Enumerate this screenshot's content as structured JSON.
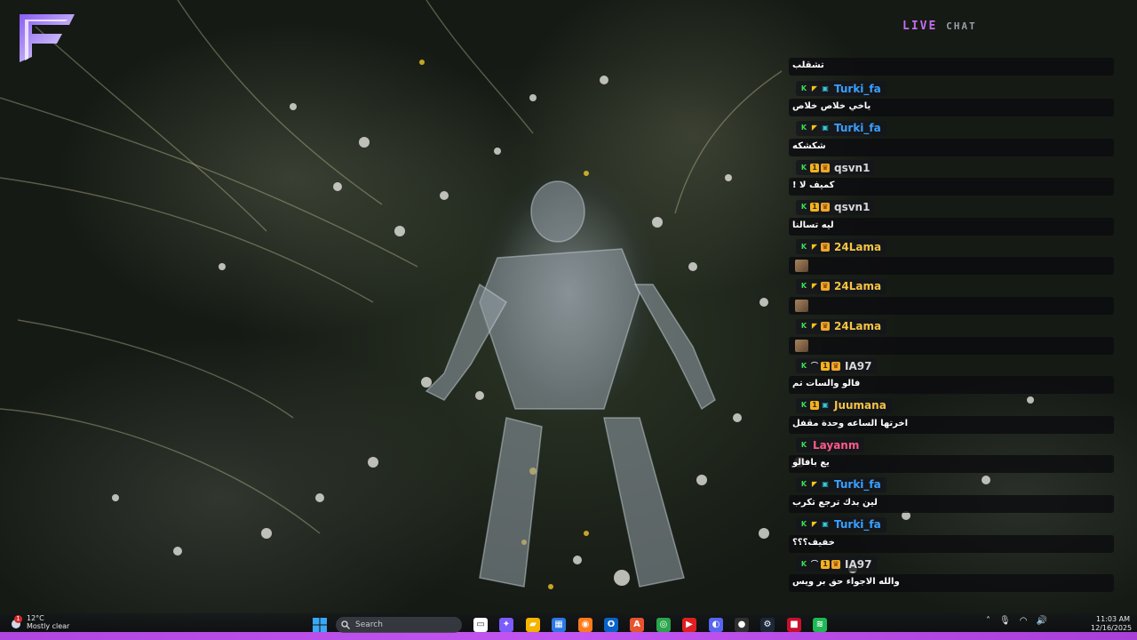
{
  "overlay": {
    "chat_title_part1": "LIVE",
    "chat_title_part2": "CHAT",
    "accent_color": "#c66bf0"
  },
  "chat": {
    "messages": [
      {
        "user": "",
        "color": "#ffffff",
        "badges": [],
        "text": "تشقلب"
      },
      {
        "user": "Turki_fa",
        "color": "#3aa0ff",
        "badges": [
          "k-icon",
          "flag-icon",
          "gamepad-icon"
        ],
        "text": "ياخي خلاص خلاص"
      },
      {
        "user": "Turki_fa",
        "color": "#3aa0ff",
        "badges": [
          "k-icon",
          "flag-icon",
          "gamepad-icon"
        ],
        "text": "شكشكه"
      },
      {
        "user": "qsvn1",
        "color": "#d7d7d7",
        "badges": [
          "k-icon",
          "coin-icon",
          "crown-icon"
        ],
        "text": "كميف لا !"
      },
      {
        "user": "qsvn1",
        "color": "#d7d7d7",
        "badges": [
          "k-icon",
          "coin-icon",
          "crown-icon"
        ],
        "text": "ليه تسالنا"
      },
      {
        "user": "24Lama",
        "color": "#f5c542",
        "badges": [
          "k-icon",
          "flag-icon",
          "crown-icon"
        ],
        "text": "",
        "emote": true
      },
      {
        "user": "24Lama",
        "color": "#f5c542",
        "badges": [
          "k-icon",
          "flag-icon",
          "crown-icon"
        ],
        "text": "",
        "emote": true
      },
      {
        "user": "24Lama",
        "color": "#f5c542",
        "badges": [
          "k-icon",
          "flag-icon",
          "crown-icon"
        ],
        "text": "",
        "emote": true
      },
      {
        "user": "IA97",
        "color": "#d7d7d7",
        "badges": [
          "k-icon",
          "dash-icon",
          "coin-icon",
          "crown-icon"
        ],
        "text": "فالو والسات تم"
      },
      {
        "user": "Juumana",
        "color": "#f5c542",
        "badges": [
          "k-icon",
          "coin-icon",
          "gamepad-icon"
        ],
        "text": "اخرتها الساعه وحدة مقفل"
      },
      {
        "user": "Layanm",
        "color": "#ff5a8a",
        "badges": [
          "k-icon"
        ],
        "text": "يع بافالو"
      },
      {
        "user": "Turki_fa",
        "color": "#3aa0ff",
        "badges": [
          "k-icon",
          "flag-icon",
          "gamepad-icon"
        ],
        "text": "لين بدك ترجع تكرب"
      },
      {
        "user": "Turki_fa",
        "color": "#3aa0ff",
        "badges": [
          "k-icon",
          "flag-icon",
          "gamepad-icon"
        ],
        "text": "خفيف؟؟؟"
      },
      {
        "user": "IA97",
        "color": "#d7d7d7",
        "badges": [
          "k-icon",
          "dash-icon",
          "coin-icon",
          "crown-icon"
        ],
        "text": "والله الاجواء حق بر ويس"
      }
    ]
  },
  "taskbar": {
    "weather_temp": "12°C",
    "weather_desc": "Mostly clear",
    "notification_count": "1",
    "search_placeholder": "Search",
    "time": "11:03 AM",
    "date": "12/16/2025",
    "apps": [
      {
        "name": "file-explorer-icon",
        "bg": "#ffffff",
        "glyph": "▭"
      },
      {
        "name": "copilot-icon",
        "bg": "#7c5cff",
        "glyph": "✦"
      },
      {
        "name": "folder-icon",
        "bg": "#f4b400",
        "glyph": "▰"
      },
      {
        "name": "store-icon",
        "bg": "#2b78e4",
        "glyph": "▦"
      },
      {
        "name": "firefox-icon",
        "bg": "#ff7a1a",
        "glyph": "◉"
      },
      {
        "name": "outlook-icon",
        "bg": "#0a64c8",
        "glyph": "O"
      },
      {
        "name": "office-icon",
        "bg": "#e8542f",
        "glyph": "A"
      },
      {
        "name": "chrome-icon",
        "bg": "#2aa54b",
        "glyph": "◎"
      },
      {
        "name": "app-icon",
        "bg": "#e02020",
        "glyph": "▶"
      },
      {
        "name": "discord-icon",
        "bg": "#5865f2",
        "glyph": "◐"
      },
      {
        "name": "obs-icon",
        "bg": "#303030",
        "glyph": "●"
      },
      {
        "name": "steam-icon",
        "bg": "#1b2838",
        "glyph": "⚙"
      },
      {
        "name": "media-icon",
        "bg": "#c8102e",
        "glyph": "■"
      },
      {
        "name": "spotify-icon",
        "bg": "#1db954",
        "glyph": "≋"
      }
    ]
  }
}
